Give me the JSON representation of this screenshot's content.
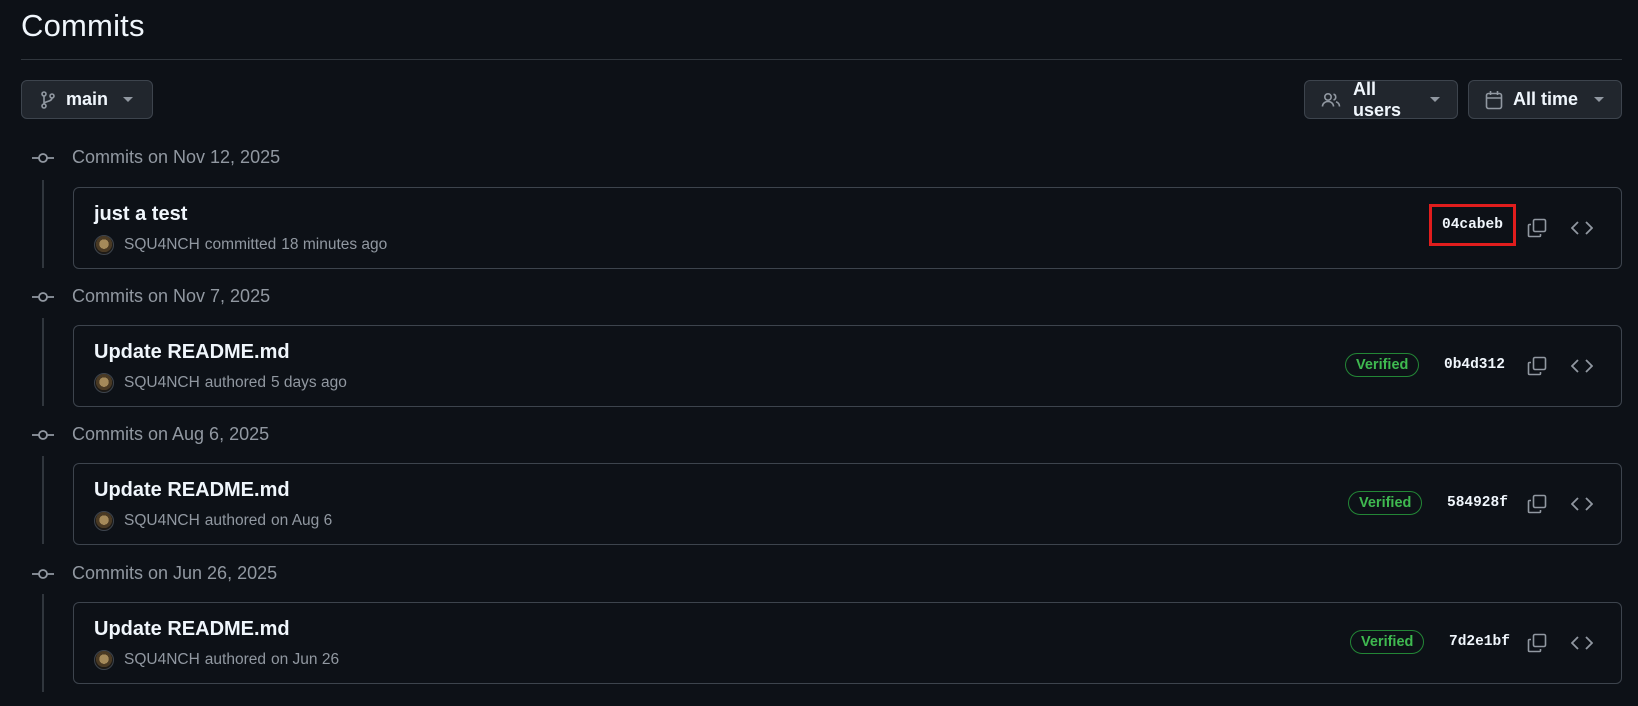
{
  "page": {
    "title": "Commits"
  },
  "toolbar": {
    "branch": {
      "label": "main",
      "icon": "git-branch-icon"
    },
    "users": {
      "label": "All users",
      "icon": "people-icon"
    },
    "time": {
      "label": "All time",
      "icon": "calendar-icon"
    }
  },
  "groups": [
    {
      "heading": "Commits on Nov 12, 2025",
      "commit": {
        "message": "just a test",
        "author": "SQU4NCH",
        "action": "committed",
        "when": "18 minutes ago",
        "verified": "",
        "sha": "04cabeb"
      }
    },
    {
      "heading": "Commits on Nov 7, 2025",
      "commit": {
        "message": "Update README.md",
        "author": "SQU4NCH",
        "action": "authored",
        "when": "5 days ago",
        "verified": "Verified",
        "sha": "0b4d312"
      }
    },
    {
      "heading": "Commits on Aug 6, 2025",
      "commit": {
        "message": "Update README.md",
        "author": "SQU4NCH",
        "action": "authored",
        "when": "on Aug 6",
        "verified": "Verified",
        "sha": "584928f"
      }
    },
    {
      "heading": "Commits on Jun 26, 2025",
      "commit": {
        "message": "Update README.md",
        "author": "SQU4NCH",
        "action": "authored",
        "when": "on Jun 26",
        "verified": "Verified",
        "sha": "7d2e1bf"
      }
    }
  ],
  "colors": {
    "background": "#0d1117",
    "border": "#3d444d",
    "verified": "#3fb950",
    "highlight": "#e11d1d"
  }
}
